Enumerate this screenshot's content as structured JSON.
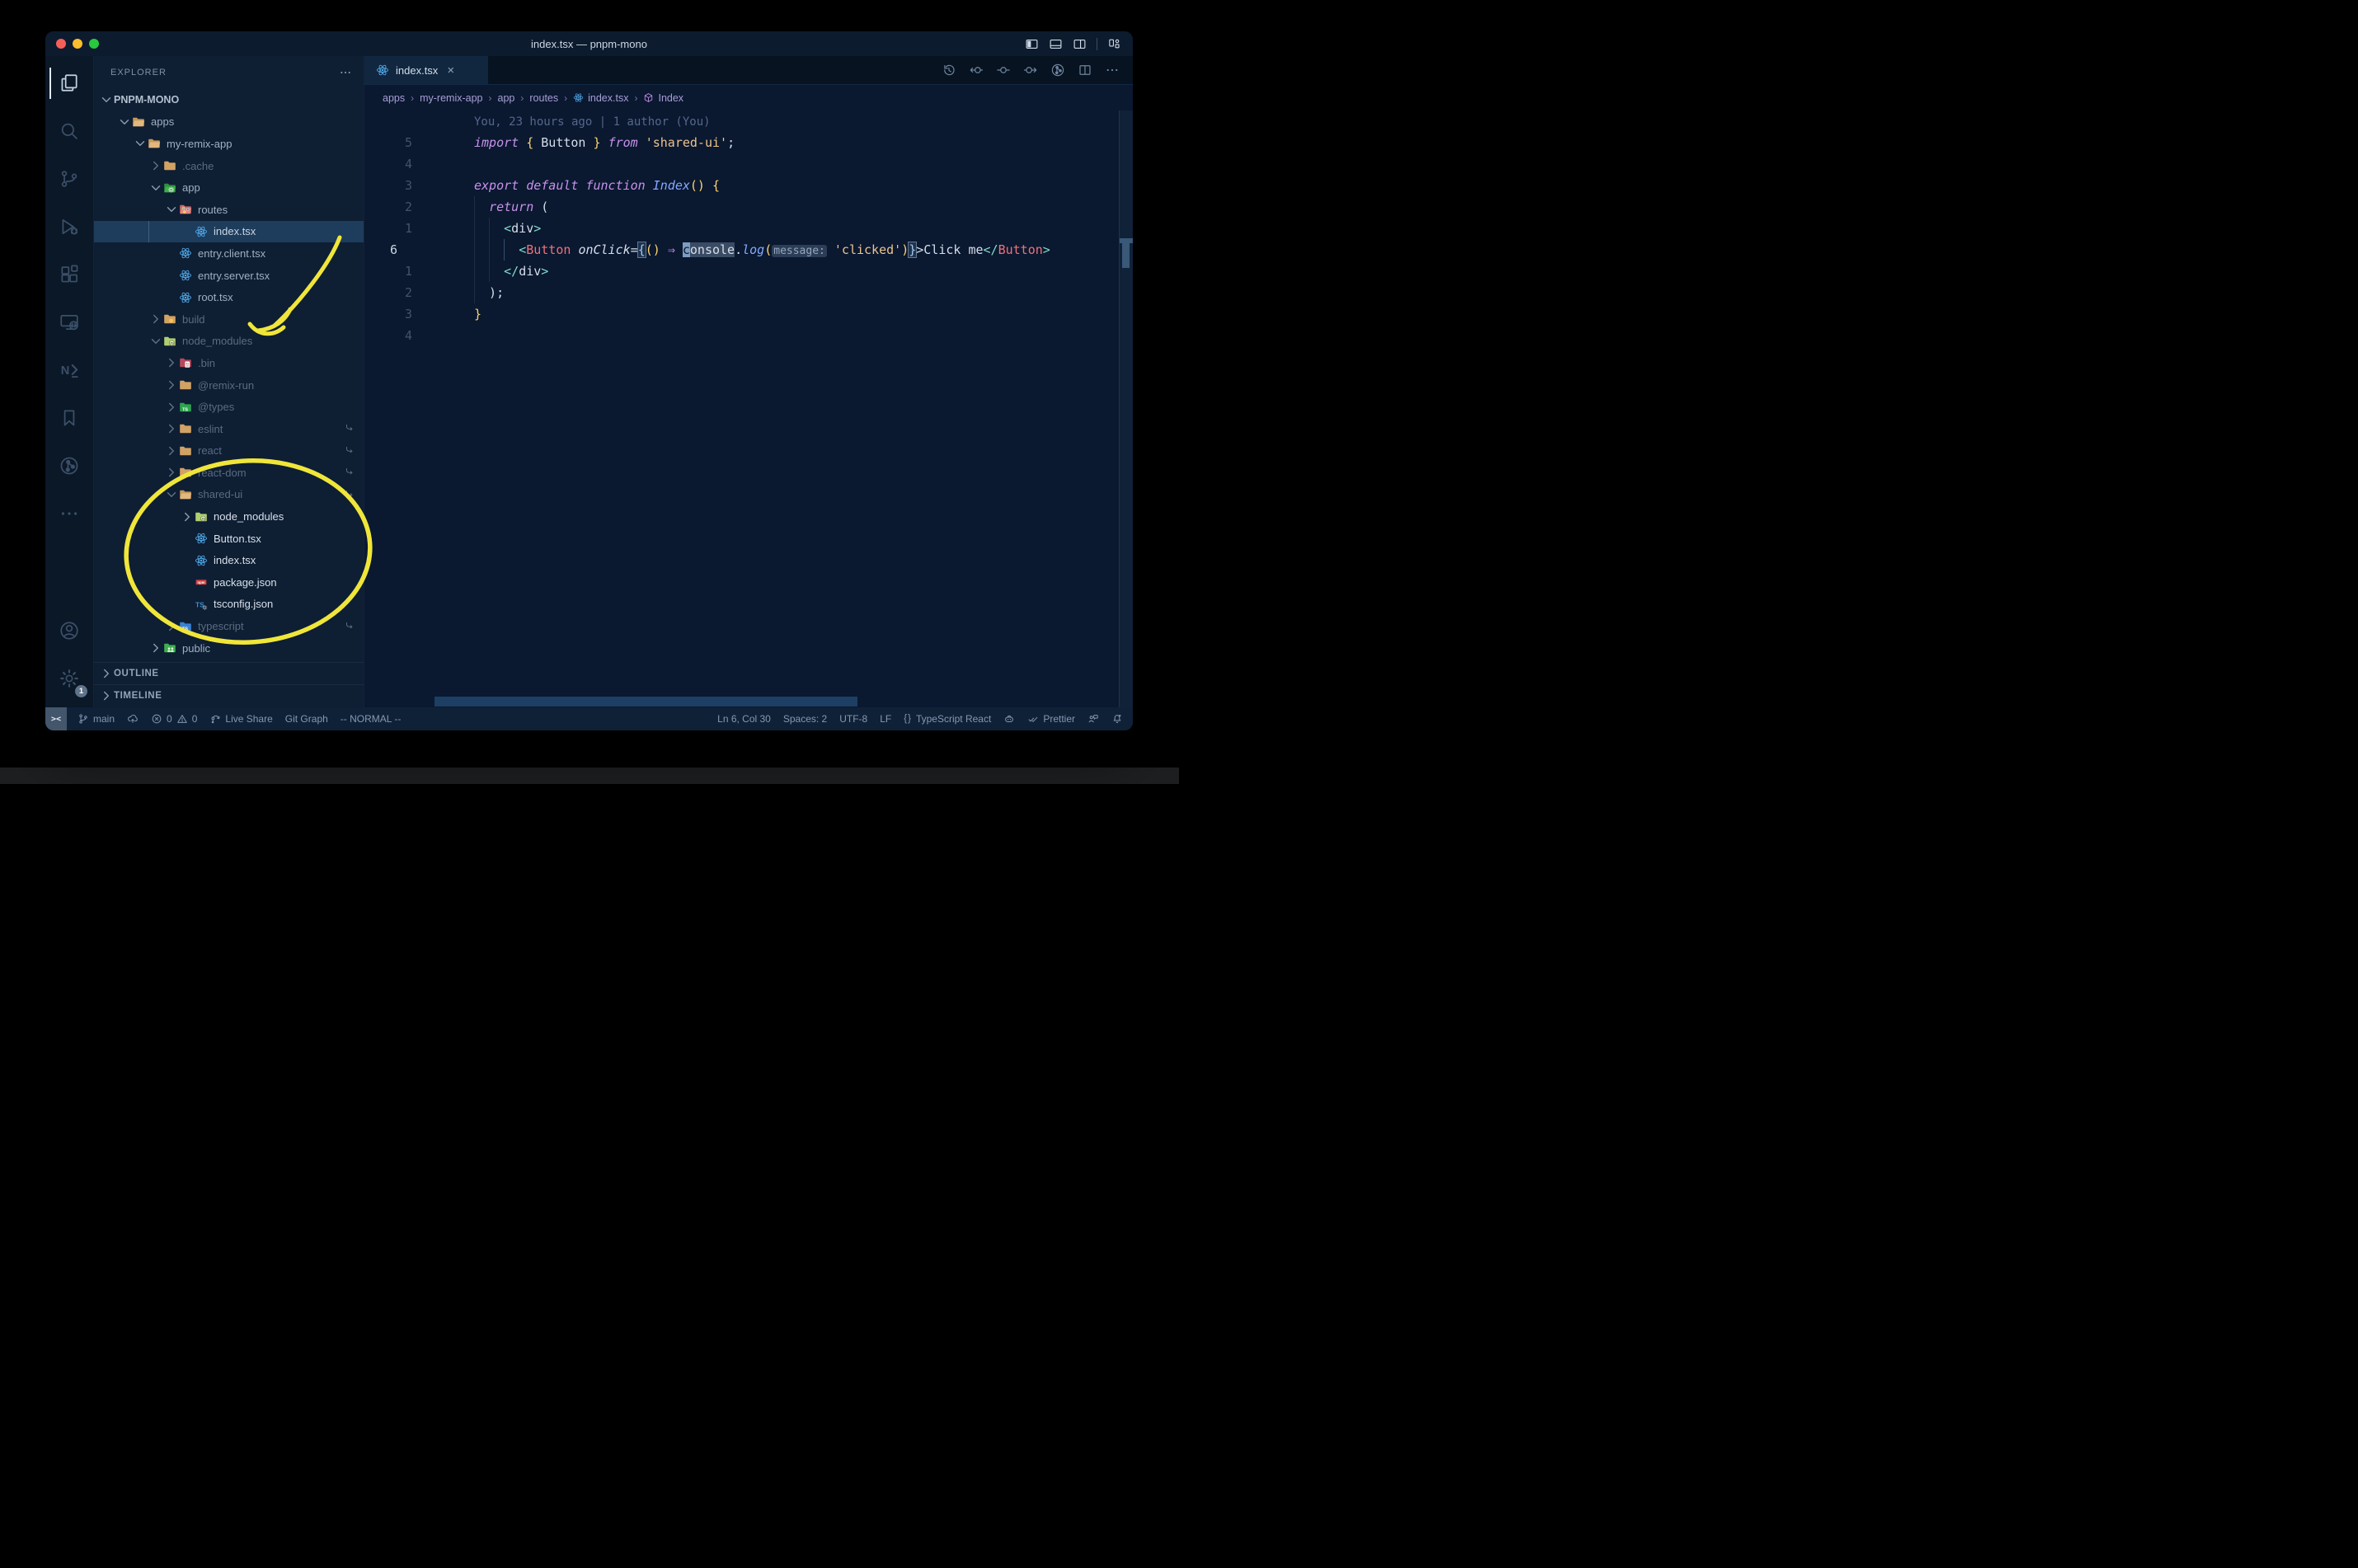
{
  "window": {
    "title": "index.tsx — pnpm-mono"
  },
  "title_bar": {
    "traffic_lights": [
      "close",
      "minimize",
      "zoom"
    ],
    "layout_icons": [
      "layout-sidebar-left-icon",
      "layout-panel-icon",
      "layout-sidebar-right-icon",
      "layout-customize-icon"
    ]
  },
  "activity_bar": {
    "top": [
      {
        "name": "explorer",
        "icon": "files-icon",
        "active": true
      },
      {
        "name": "search",
        "icon": "search-icon"
      },
      {
        "name": "source-control",
        "icon": "source-control-icon"
      },
      {
        "name": "run-debug",
        "icon": "debug-icon"
      },
      {
        "name": "extensions",
        "icon": "extensions-icon"
      },
      {
        "name": "remote-explorer",
        "icon": "remote-explorer-icon"
      },
      {
        "name": "nx-console",
        "icon": "nx-icon"
      },
      {
        "name": "bookmarks",
        "icon": "bookmark-icon"
      },
      {
        "name": "git-graph",
        "icon": "git-graph-circle-icon"
      },
      {
        "name": "more",
        "icon": "ellipsis-icon"
      }
    ],
    "bottom": [
      {
        "name": "accounts",
        "icon": "account-icon"
      },
      {
        "name": "settings",
        "icon": "gear-icon",
        "badge": "1"
      }
    ]
  },
  "explorer": {
    "header": "EXPLORER",
    "items": [
      {
        "label": "PNPM-MONO",
        "depth": 0,
        "chevron": "down",
        "root": true
      },
      {
        "label": "apps",
        "depth": 1,
        "chevron": "down",
        "icon": "folder-open-tan"
      },
      {
        "label": "my-remix-app",
        "depth": 2,
        "chevron": "down",
        "icon": "folder-open-tan"
      },
      {
        "label": ".cache",
        "depth": 3,
        "chevron": "right",
        "icon": "folder-tan",
        "dim": true
      },
      {
        "label": "app",
        "depth": 3,
        "chevron": "down",
        "icon": "folder-app"
      },
      {
        "label": "routes",
        "depth": 4,
        "chevron": "down",
        "icon": "folder-routes"
      },
      {
        "label": "index.tsx",
        "depth": 5,
        "file": true,
        "icon": "react-icon",
        "selected": true
      },
      {
        "label": "entry.client.tsx",
        "depth": 4,
        "file": true,
        "icon": "react-icon"
      },
      {
        "label": "entry.server.tsx",
        "depth": 4,
        "file": true,
        "icon": "react-icon"
      },
      {
        "label": "root.tsx",
        "depth": 4,
        "file": true,
        "icon": "react-icon"
      },
      {
        "label": "build",
        "depth": 3,
        "chevron": "right",
        "icon": "folder-build",
        "dim": true
      },
      {
        "label": "node_modules",
        "depth": 3,
        "chevron": "down",
        "icon": "folder-npm",
        "dim": true
      },
      {
        "label": ".bin",
        "depth": 4,
        "chevron": "right",
        "icon": "folder-bin",
        "dim": true
      },
      {
        "label": "@remix-run",
        "depth": 4,
        "chevron": "right",
        "icon": "folder-tan",
        "dim": true
      },
      {
        "label": "@types",
        "depth": 4,
        "chevron": "right",
        "icon": "folder-types",
        "dim": true
      },
      {
        "label": "eslint",
        "depth": 4,
        "chevron": "right",
        "icon": "folder-tan",
        "dim": true,
        "symlink": true
      },
      {
        "label": "react",
        "depth": 4,
        "chevron": "right",
        "icon": "folder-tan",
        "dim": true,
        "symlink": true
      },
      {
        "label": "react-dom",
        "depth": 4,
        "chevron": "right",
        "icon": "folder-tan",
        "dim": true,
        "symlink": true
      },
      {
        "label": "shared-ui",
        "depth": 4,
        "chevron": "down",
        "icon": "folder-open-tan",
        "dim": true,
        "symlink": true
      },
      {
        "label": "node_modules",
        "depth": 5,
        "chevron": "right",
        "icon": "folder-npm",
        "bright": true
      },
      {
        "label": "Button.tsx",
        "depth": 5,
        "file": true,
        "icon": "react-icon",
        "bright": true
      },
      {
        "label": "index.tsx",
        "depth": 5,
        "file": true,
        "icon": "react-icon",
        "bright": true
      },
      {
        "label": "package.json",
        "depth": 5,
        "file": true,
        "icon": "npm-file-icon",
        "bright": true
      },
      {
        "label": "tsconfig.json",
        "depth": 5,
        "file": true,
        "icon": "tsconfig-icon",
        "bright": true
      },
      {
        "label": "typescript",
        "depth": 4,
        "chevron": "right",
        "icon": "folder-ts",
        "dim": true,
        "symlink": true
      },
      {
        "label": "public",
        "depth": 3,
        "chevron": "right",
        "icon": "folder-public"
      }
    ],
    "sections": [
      {
        "label": "OUTLINE"
      },
      {
        "label": "TIMELINE"
      }
    ]
  },
  "tab_bar": {
    "tabs": [
      {
        "label": "index.tsx",
        "icon": "react-icon",
        "close": "×",
        "active": true
      }
    ],
    "actions": [
      "history-icon",
      "change-prev-icon",
      "change-icon",
      "change-next-icon",
      "gitlens-graph-icon",
      "split-editor-icon",
      "ellipsis-icon"
    ]
  },
  "breadcrumbs": {
    "separator": "›",
    "items": [
      {
        "label": "apps"
      },
      {
        "label": "my-remix-app"
      },
      {
        "label": "app"
      },
      {
        "label": "routes"
      },
      {
        "label": "index.tsx",
        "icon": "react-icon"
      },
      {
        "label": "Index",
        "icon": "symbol-cube-icon"
      }
    ]
  },
  "editor": {
    "blame": "You, 23 hours ago | 1 author (You)",
    "lines": [
      {
        "num": "5",
        "guides": [],
        "tokens": [
          {
            "t": "import",
            "c": "kw"
          },
          {
            "t": " ",
            "c": "pl"
          },
          {
            "t": "{",
            "c": "y"
          },
          {
            "t": " Button ",
            "c": "pl"
          },
          {
            "t": "}",
            "c": "y"
          },
          {
            "t": " ",
            "c": "pl"
          },
          {
            "t": "from",
            "c": "kw"
          },
          {
            "t": " ",
            "c": "pl"
          },
          {
            "t": "'shared-ui'",
            "c": "str"
          },
          {
            "t": ";",
            "c": "pl"
          }
        ]
      },
      {
        "num": "4",
        "guides": [],
        "tokens": []
      },
      {
        "num": "3",
        "guides": [],
        "tokens": [
          {
            "t": "export",
            "c": "kw"
          },
          {
            "t": " ",
            "c": "pl"
          },
          {
            "t": "default",
            "c": "kw"
          },
          {
            "t": " ",
            "c": "pl"
          },
          {
            "t": "function",
            "c": "kw"
          },
          {
            "t": " ",
            "c": "pl"
          },
          {
            "t": "Index",
            "c": "fn"
          },
          {
            "t": "()",
            "c": "y"
          },
          {
            "t": " ",
            "c": "pl"
          },
          {
            "t": "{",
            "c": "y"
          }
        ]
      },
      {
        "num": "2",
        "guides": [
          0
        ],
        "tokens": [
          {
            "t": "  ",
            "c": "pl"
          },
          {
            "t": "return",
            "c": "kw"
          },
          {
            "t": " (",
            "c": "pl"
          }
        ]
      },
      {
        "num": "1",
        "guides": [
          0,
          2
        ],
        "tokens": [
          {
            "t": "    ",
            "c": "pl"
          },
          {
            "t": "<",
            "c": "teal"
          },
          {
            "t": "div",
            "c": "pl"
          },
          {
            "t": ">",
            "c": "teal"
          }
        ]
      },
      {
        "num": "6",
        "current": true,
        "guides": [
          0,
          2
        ],
        "active_guide": 4,
        "tokens": [
          {
            "t": "      ",
            "c": "pl"
          },
          {
            "t": "<",
            "c": "teal"
          },
          {
            "t": "Button",
            "c": "tag"
          },
          {
            "t": " ",
            "c": "pl"
          },
          {
            "t": "onClick",
            "c": "attr"
          },
          {
            "t": "=",
            "c": "pl"
          },
          {
            "t": "{",
            "c": "brbox"
          },
          {
            "t": "()",
            "c": "y"
          },
          {
            "t": " ",
            "c": "pl"
          },
          {
            "t": "⇒",
            "c": "kw"
          },
          {
            "t": " ",
            "c": "pl"
          },
          {
            "t": "c",
            "c": "cur"
          },
          {
            "t": "onsole",
            "c": "sel"
          },
          {
            "t": ".",
            "c": "pl"
          },
          {
            "t": "log",
            "c": "fn"
          },
          {
            "t": "(",
            "c": "y"
          },
          {
            "t": "message:",
            "c": "inlay"
          },
          {
            "t": " ",
            "c": "pl"
          },
          {
            "t": "'clicked'",
            "c": "str"
          },
          {
            "t": ")",
            "c": "y"
          },
          {
            "t": "}",
            "c": "brbox"
          },
          {
            "t": ">",
            "c": "pl"
          },
          {
            "t": "Click me",
            "c": "pl"
          },
          {
            "t": "</",
            "c": "teal"
          },
          {
            "t": "Button",
            "c": "tag"
          },
          {
            "t": ">",
            "c": "teal"
          }
        ]
      },
      {
        "num": "1",
        "guides": [
          0,
          2
        ],
        "tokens": [
          {
            "t": "    ",
            "c": "pl"
          },
          {
            "t": "</",
            "c": "teal"
          },
          {
            "t": "div",
            "c": "pl"
          },
          {
            "t": ">",
            "c": "teal"
          }
        ]
      },
      {
        "num": "2",
        "guides": [
          0
        ],
        "tokens": [
          {
            "t": "  );",
            "c": "pl"
          }
        ]
      },
      {
        "num": "3",
        "guides": [],
        "tokens": [
          {
            "t": "}",
            "c": "y"
          }
        ]
      },
      {
        "num": "4",
        "guides": [],
        "tokens": []
      }
    ]
  },
  "status_bar": {
    "remote_indicator": "><",
    "left": [
      {
        "name": "git-branch",
        "parts": [
          {
            "icon": "branch-icon"
          },
          {
            "text": "main"
          }
        ]
      },
      {
        "name": "publish",
        "parts": [
          {
            "icon": "cloud-upload-icon"
          }
        ]
      },
      {
        "name": "problems",
        "parts": [
          {
            "icon": "error-icon"
          },
          {
            "text": "0"
          },
          {
            "icon": "warning-icon"
          },
          {
            "text": "0"
          }
        ]
      },
      {
        "name": "live-share",
        "parts": [
          {
            "icon": "live-share-icon"
          },
          {
            "text": "Live Share"
          }
        ]
      },
      {
        "name": "git-graph",
        "parts": [
          {
            "text": "Git Graph"
          }
        ]
      },
      {
        "name": "vim-mode",
        "parts": [
          {
            "text": "-- NORMAL --"
          }
        ]
      }
    ],
    "right": [
      {
        "name": "cursor-position",
        "parts": [
          {
            "text": "Ln 6, Col 30"
          }
        ]
      },
      {
        "name": "indentation",
        "parts": [
          {
            "text": "Spaces: 2"
          }
        ]
      },
      {
        "name": "encoding",
        "parts": [
          {
            "text": "UTF-8"
          }
        ]
      },
      {
        "name": "eol",
        "parts": [
          {
            "text": "LF"
          }
        ]
      },
      {
        "name": "language-mode",
        "parts": [
          {
            "tic": "{}"
          },
          {
            "text": "TypeScript React"
          }
        ]
      },
      {
        "name": "copilot",
        "parts": [
          {
            "icon": "copilot-icon"
          }
        ]
      },
      {
        "name": "prettier",
        "parts": [
          {
            "icon": "double-check-icon"
          },
          {
            "text": "Prettier"
          }
        ]
      },
      {
        "name": "feedback",
        "parts": [
          {
            "icon": "feedback-icon"
          }
        ]
      },
      {
        "name": "notifications",
        "parts": [
          {
            "icon": "bell-dot-icon"
          }
        ]
      }
    ]
  },
  "annotations": {
    "color": "#f0e63a",
    "shapes": [
      "hand-drawn-arrow-to-node-modules",
      "hand-drawn-ellipse-around-shared-ui-files"
    ]
  },
  "colors": {
    "editor_bg": "#0a1830",
    "sidebar_bg": "#0e1e33",
    "titlebar_bg": "#0d1b2e",
    "statusbar_bg": "#0f2137",
    "selection_row": "#1e3c5c",
    "accent_yellow": "#f0e63a",
    "traffic_red": "#f65f58",
    "traffic_yellow": "#fcbd2e",
    "traffic_green": "#29c83f"
  }
}
